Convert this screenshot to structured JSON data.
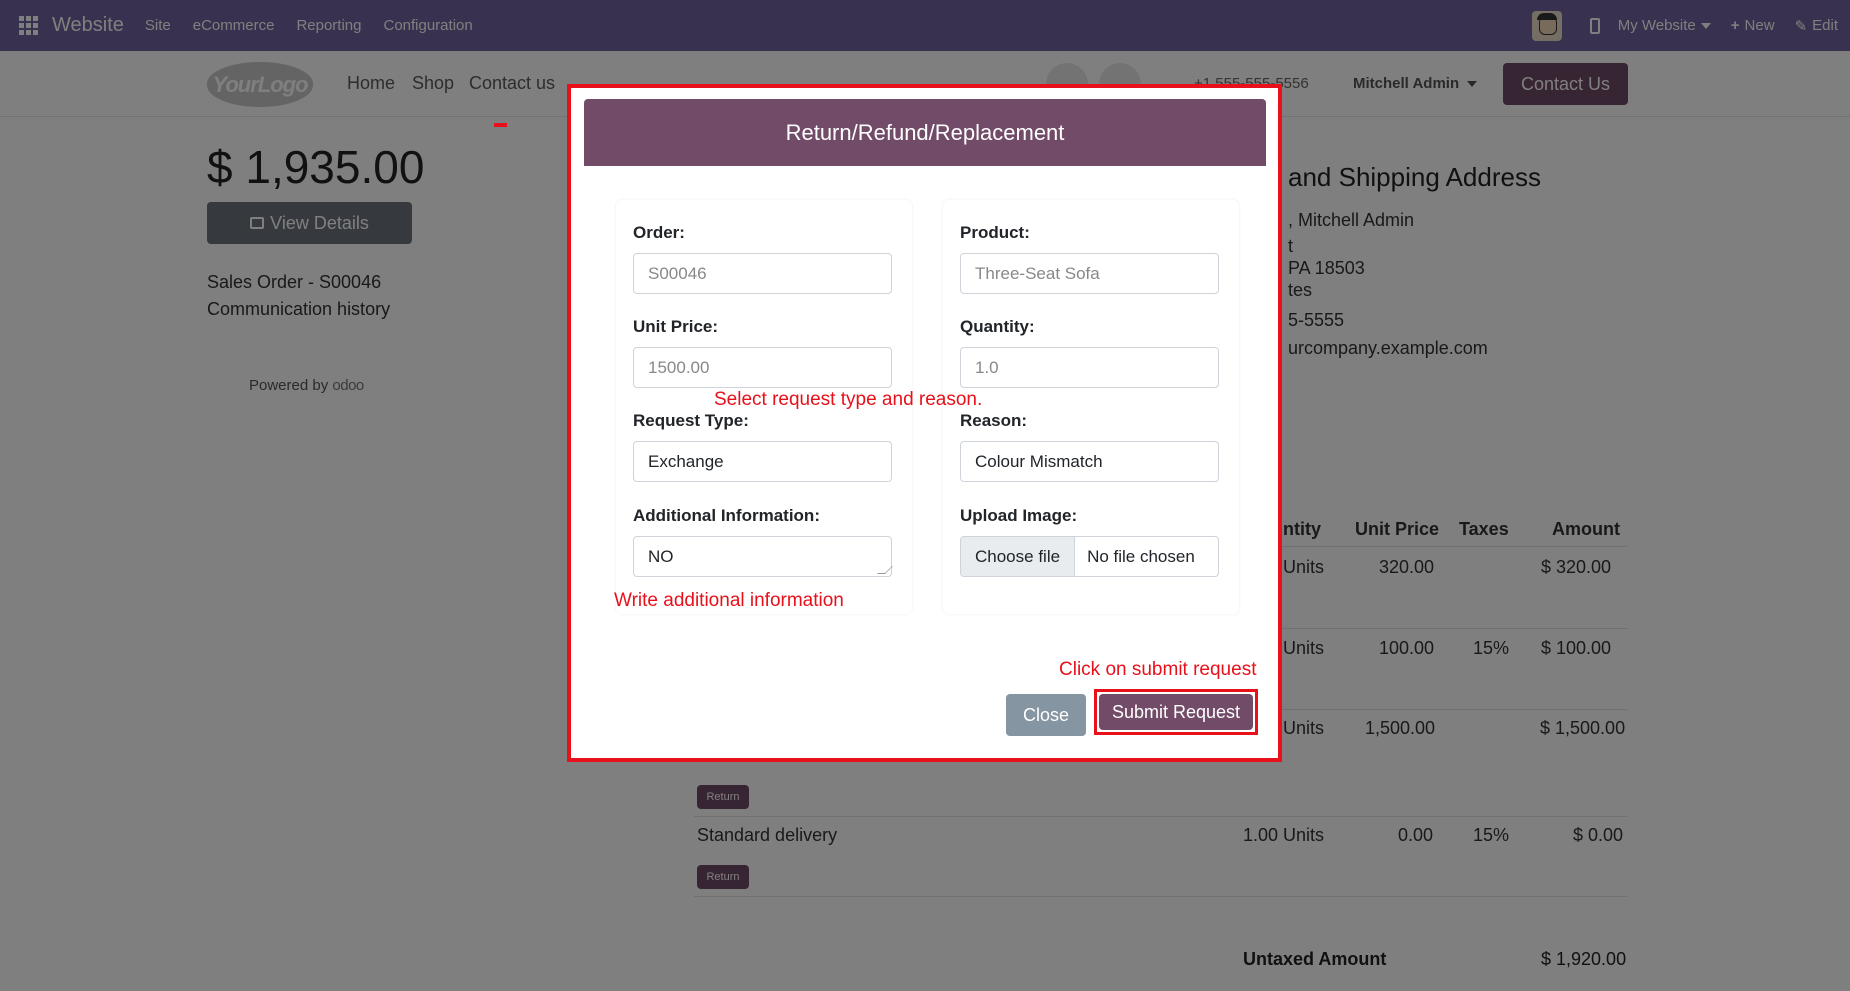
{
  "topbar": {
    "app_name": "Website",
    "menu": [
      "Site",
      "eCommerce",
      "Reporting",
      "Configuration"
    ],
    "website_selector": "My Website",
    "new_label": "New",
    "edit_label": "Edit"
  },
  "site_header": {
    "logo_text": "YourLogo",
    "nav": [
      "Home",
      "Shop",
      "Contact us"
    ],
    "phone": "+1 555-555-5556",
    "user": "Mitchell Admin",
    "contact_btn": "Contact Us"
  },
  "sidebar": {
    "amount": "$ 1,935.00",
    "view_details": "View Details",
    "sales_order": "Sales Order - S00046",
    "communication": "Communication history",
    "powered_by": "Powered by",
    "powered_brand": "odoo"
  },
  "address": {
    "title": "and Shipping Address",
    "lines": [
      ", Mitchell Admin",
      "t",
      "PA 18503",
      "tes",
      "5-5555",
      "urcompany.example.com"
    ]
  },
  "order_table": {
    "headers": [
      "ntity",
      "Unit Price",
      "Taxes",
      "Amount"
    ],
    "rows": [
      {
        "qty": "Units",
        "price": "320.00",
        "tax": "",
        "amount": "$ 320.00"
      },
      {
        "qty": "Units",
        "price": "100.00",
        "tax": "15%",
        "amount": "$ 100.00"
      },
      {
        "qty": "Units",
        "price": "1,500.00",
        "tax": "",
        "amount": "$ 1,500.00"
      },
      {
        "name": "Standard delivery",
        "qty": "1.00 Units",
        "price": "0.00",
        "tax": "15%",
        "amount": "$ 0.00"
      }
    ],
    "return_label": "Return",
    "untaxed_label": "Untaxed Amount",
    "untaxed_value": "$ 1,920.00"
  },
  "modal": {
    "title": "Return/Refund/Replacement",
    "order_label": "Order:",
    "order_value": "S00046",
    "product_label": "Product:",
    "product_value": "Three-Seat Sofa",
    "unit_price_label": "Unit Price:",
    "unit_price_value": "1500.00",
    "quantity_label": "Quantity:",
    "quantity_value": "1.0",
    "request_type_label": "Request Type:",
    "request_type_value": "Exchange",
    "reason_label": "Reason:",
    "reason_value": "Colour Mismatch",
    "additional_label": "Additional Information:",
    "additional_value": "NO",
    "upload_label": "Upload Image:",
    "choose_file": "Choose file",
    "no_file": "No file chosen",
    "close_btn": "Close",
    "submit_btn": "Submit Request"
  },
  "annotations": {
    "select_request": "Select request type and reason.",
    "write_info": "Write additional information",
    "click_submit": "Click on submit request"
  },
  "colors": {
    "topbar": "#71639e",
    "primary": "#714b67",
    "annotation_red": "#e8101a"
  }
}
